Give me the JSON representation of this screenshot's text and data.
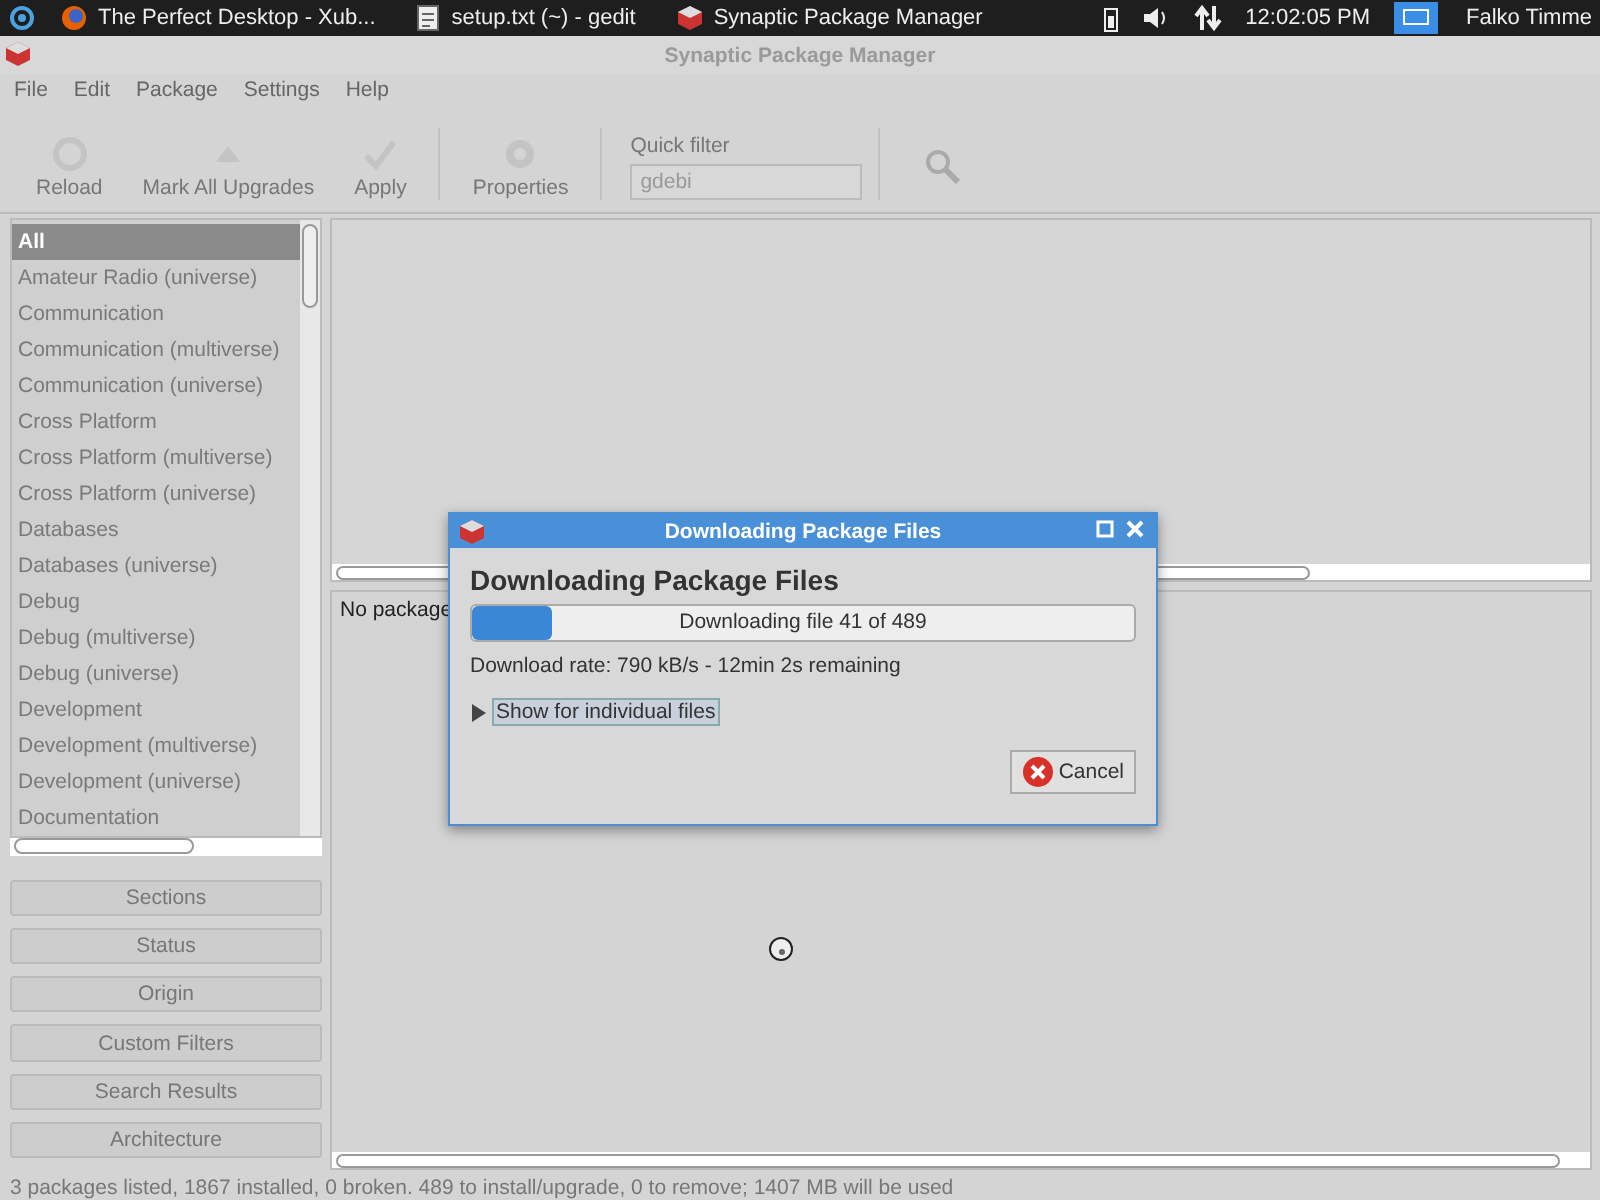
{
  "taskbar": {
    "tasks": [
      {
        "label": "The Perfect Desktop - Xub...",
        "kind": "browser"
      },
      {
        "label": "setup.txt (~) - gedit",
        "kind": "editor"
      },
      {
        "label": "Synaptic Package Manager",
        "kind": "package"
      }
    ],
    "clock": "12:02:05 PM",
    "user": "Falko Timme"
  },
  "window": {
    "title": "Synaptic Package Manager"
  },
  "menu": [
    "File",
    "Edit",
    "Package",
    "Settings",
    "Help"
  ],
  "toolbar": {
    "buttons": [
      {
        "label": "Reload",
        "kind": "reload"
      },
      {
        "label": "Mark All Upgrades",
        "kind": "upgrade"
      },
      {
        "label": "Apply",
        "kind": "apply"
      },
      {
        "label": "Properties",
        "kind": "properties"
      }
    ],
    "filter_label": "Quick filter",
    "filter_value": "gdebi"
  },
  "sections": [
    {
      "label": "All",
      "selected": true
    },
    {
      "label": "Amateur Radio (universe)",
      "selected": false
    },
    {
      "label": "Communication",
      "selected": false
    },
    {
      "label": "Communication (multiverse)",
      "selected": false
    },
    {
      "label": "Communication (universe)",
      "selected": false
    },
    {
      "label": "Cross Platform",
      "selected": false
    },
    {
      "label": "Cross Platform (multiverse)",
      "selected": false
    },
    {
      "label": "Cross Platform (universe)",
      "selected": false
    },
    {
      "label": "Databases",
      "selected": false
    },
    {
      "label": "Databases (universe)",
      "selected": false
    },
    {
      "label": "Debug",
      "selected": false
    },
    {
      "label": "Debug (multiverse)",
      "selected": false
    },
    {
      "label": "Debug (universe)",
      "selected": false
    },
    {
      "label": "Development",
      "selected": false
    },
    {
      "label": "Development (multiverse)",
      "selected": false
    },
    {
      "label": "Development (universe)",
      "selected": false
    },
    {
      "label": "Documentation",
      "selected": false
    }
  ],
  "filter_buttons": [
    "Sections",
    "Status",
    "Origin",
    "Custom Filters",
    "Search Results",
    "Architecture"
  ],
  "details_text": "No package",
  "status_bar": "3 packages listed, 1867 installed, 0 broken. 489 to install/upgrade, 0 to remove; 1407 MB will be used",
  "dialog": {
    "title": "Downloading Package Files",
    "heading": "Downloading Package Files",
    "progress": {
      "level": 0.12,
      "text": "Downloading file 41 of 489"
    },
    "rate": "Download rate: 790 kB/s - 12min 2s remaining",
    "expander": {
      "label": "Show for individual files",
      "expanded": false
    },
    "cancel": "Cancel"
  }
}
